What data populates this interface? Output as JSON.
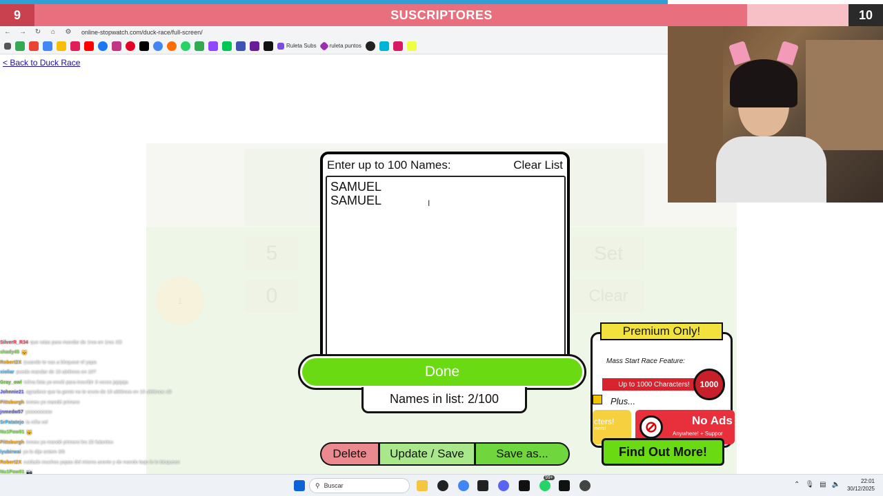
{
  "subscriber_bar": {
    "current": "9",
    "title": "SUSCRIPTORES",
    "goal": "10",
    "progress_fraction": 0.85
  },
  "browser": {
    "url": "online-stopwatch.com/duck-race/full-screen/",
    "bookmarks": [
      {
        "label": "Ruleta Subs",
        "color": "#7b4ce0"
      },
      {
        "label": "ruleta puntos",
        "color": "#9b2fb0"
      }
    ]
  },
  "page": {
    "back_link": "< Back to Duck Race"
  },
  "modal": {
    "heading": "Enter up to 100 Names:",
    "clear_label": "Clear List",
    "names": [
      "SAMUEL",
      "SAMUEL"
    ],
    "done_label": "Done",
    "count_label": "Names in list: 2/100"
  },
  "bottom_buttons": {
    "delete": "Delete",
    "update": "Update / Save",
    "save_as": "Save as..."
  },
  "premium": {
    "title": "Premium Only!",
    "feature": "Mass Start Race Feature:",
    "chars": "Up to 1000 Characters!",
    "badge": "1000",
    "plus": "Plus...",
    "tile_yellow": "cters!",
    "tile_yellow_sub": "mers!",
    "no_ads": "No Ads",
    "no_ads_sub": "Anywhere! + Suppor",
    "find_out": "Find Out More!"
  },
  "ghost_background": {
    "tile1": "5",
    "tile2": "0",
    "set": "Set",
    "clear": "Clear",
    "duck_num": "1"
  },
  "chat": [
    {
      "user": "SilverR_R34",
      "color": "#e05060",
      "text": "que ratas para mandar de 1ros en 1ros XD"
    },
    {
      "user": "shady45",
      "color": "#7fd050",
      "text": "🐱"
    },
    {
      "user": "Robert2X",
      "color": "#e0a020",
      "text": "(cuando te vas a bloquear el yapa"
    },
    {
      "user": "xioliar",
      "color": "#50b0e0",
      "text": "puedo mandar de 10 alelimos en 10?"
    },
    {
      "user": "Gray_owl",
      "color": "#70c040",
      "text": "Ielina lista yo envié para inscribir 3 veces jajajaja"
    },
    {
      "user": "Johnnie21",
      "color": "#6060e0",
      "text": "agradece que la gente no te envio de 10 alétimos en 10 alétimos xD"
    },
    {
      "user": "Pittsburgh",
      "color": "#e0a020",
      "text": "inmeu yo mandé primero"
    },
    {
      "user": "jnmedw57",
      "color": "#6060e0",
      "text": "yooooooooo"
    },
    {
      "user": "SrPatatejo",
      "color": "#50b0e0",
      "text": "la niña vel"
    },
    {
      "user": "Nu1Pow01",
      "color": "#7fd050",
      "text": "🐱"
    },
    {
      "user": "Pittsburgh",
      "color": "#e0a020",
      "text": "inmeu yo mandé primero los 20 fulanitos"
    },
    {
      "user": "lyubirwai",
      "color": "#50b0e0",
      "text": "yo lo dije ontem 3/6"
    },
    {
      "user": "Robert2X",
      "color": "#e0a020",
      "text": "cuidado muchos yapas del mismo aronte y de mando bajo lo lo bloquean"
    },
    {
      "user": "Nu1Pow01",
      "color": "#7fd050",
      "text": "📷"
    }
  ],
  "taskbar": {
    "search_placeholder": "Buscar",
    "time": "22:01",
    "date": "30/12/2025",
    "badge": "99+"
  }
}
